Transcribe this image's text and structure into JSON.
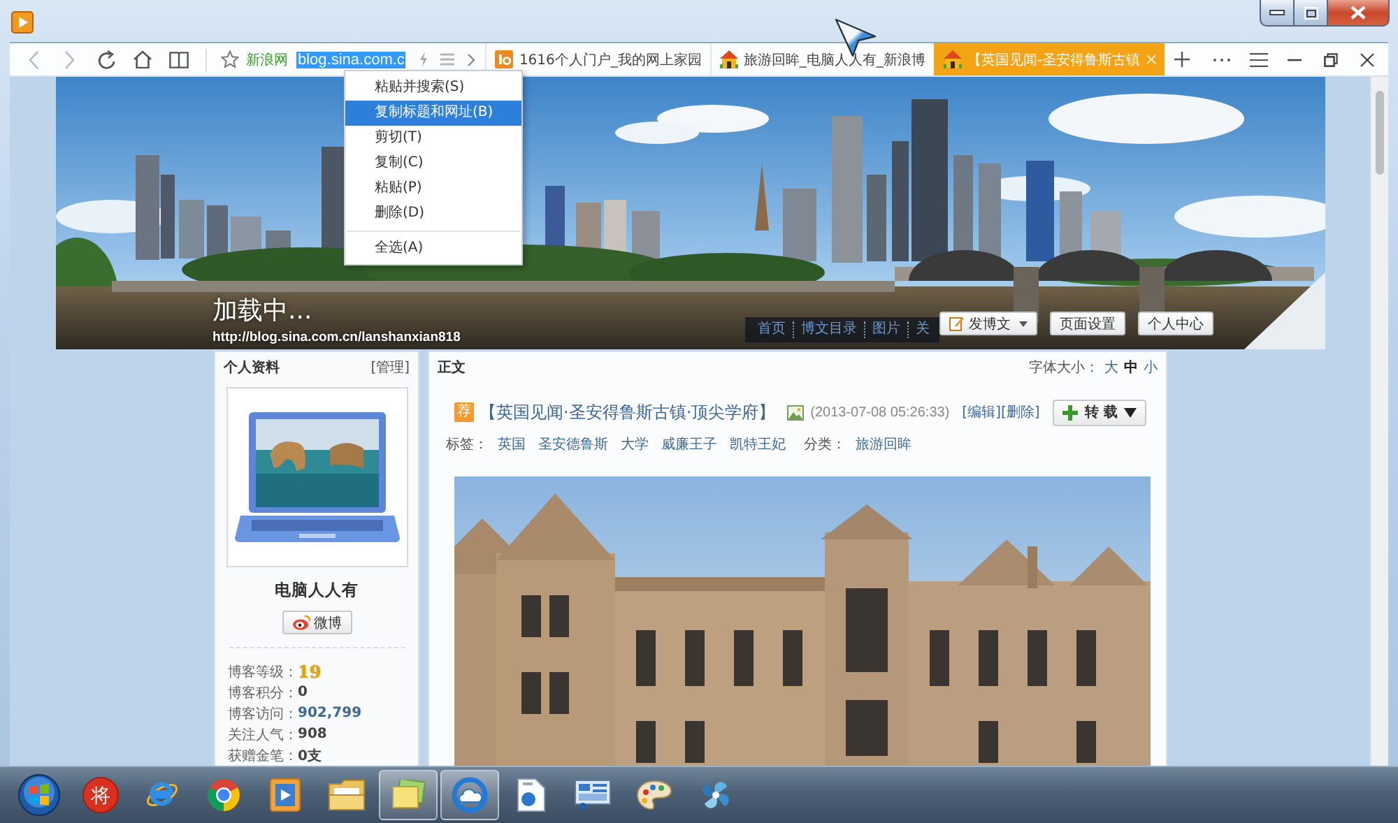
{
  "browser": {
    "site_label": "新浪网",
    "address": "blog.sina.com.c",
    "address_selected": true,
    "tabs": [
      {
        "kind": "portal",
        "label": "1616个人门户_我的网上家园",
        "selected": false
      },
      {
        "kind": "blog",
        "label": "旅游回眸_电脑人人有_新浪博",
        "selected": false
      },
      {
        "kind": "blog",
        "label": "【英国见闻-圣安得鲁斯古镇",
        "selected": true
      }
    ]
  },
  "context_menu": {
    "items": [
      {
        "kind": "item",
        "label": "粘贴并搜索(S)",
        "selected": false
      },
      {
        "kind": "item",
        "label": "复制标题和网址(B)",
        "selected": true
      },
      {
        "kind": "item",
        "label": "剪切(T)",
        "selected": false
      },
      {
        "kind": "item",
        "label": "复制(C)",
        "selected": false
      },
      {
        "kind": "item",
        "label": "粘贴(P)",
        "selected": false
      },
      {
        "kind": "item",
        "label": "删除(D)",
        "selected": false
      },
      {
        "kind": "separator"
      },
      {
        "kind": "item",
        "label": "全选(A)",
        "selected": false
      }
    ]
  },
  "banner": {
    "status": "加载中...",
    "url": "http://blog.sina.com.cn/lanshanxian818",
    "nav": [
      "首页",
      "博文目录",
      "图片",
      "关"
    ],
    "buttons": [
      {
        "kind": "dropdown",
        "label": "发博文"
      },
      {
        "kind": "plain",
        "label": "页面设置"
      },
      {
        "kind": "plain",
        "label": "个人中心"
      }
    ]
  },
  "profile": {
    "title": "个人资料",
    "manage": "[管理]",
    "name": "电脑人人有",
    "weibo": "微博",
    "stats": [
      {
        "kind": "level",
        "label": "博客等级：",
        "value": "19"
      },
      {
        "kind": "plain",
        "label": "博客积分：",
        "value": "0"
      },
      {
        "kind": "link",
        "label": "博客访问：",
        "value": "902,799"
      },
      {
        "kind": "plain",
        "label": "关注人气：",
        "value": "908"
      },
      {
        "kind": "plain",
        "label": "获赠金笔：",
        "value": "0支"
      }
    ]
  },
  "article": {
    "header": "正文",
    "font_size_label": "字体大小：",
    "font_sizes": [
      {
        "label": "大",
        "selected": false
      },
      {
        "label": "中",
        "selected": true
      },
      {
        "label": "小",
        "selected": false
      }
    ],
    "badge": "荐",
    "title": "【英国见闻·圣安得鲁斯古镇·顶尖学府】",
    "date": "(2013-07-08 05:26:33)",
    "actions": [
      "[编辑]",
      "[删除]"
    ],
    "repost": "转 载",
    "tags_label": "标签：",
    "tags": [
      "英国",
      "圣安德鲁斯",
      "大学",
      "威廉王子",
      "凯特王妃"
    ],
    "category_label": "分类：",
    "category": "旅游回眸"
  },
  "taskbar": {
    "apps": [
      {
        "kind": "chess",
        "text": "将",
        "active": false
      },
      {
        "kind": "e",
        "active": false
      },
      {
        "kind": "orb",
        "active": false
      },
      {
        "kind": "player",
        "active": false
      },
      {
        "kind": "folder",
        "active": false
      },
      {
        "kind": "notes",
        "active": true
      },
      {
        "kind": "cloud",
        "active": true
      },
      {
        "kind": "document",
        "active": false
      },
      {
        "kind": "panel",
        "active": false
      },
      {
        "kind": "palette",
        "active": false
      },
      {
        "kind": "pinwheel",
        "active": false
      }
    ]
  }
}
